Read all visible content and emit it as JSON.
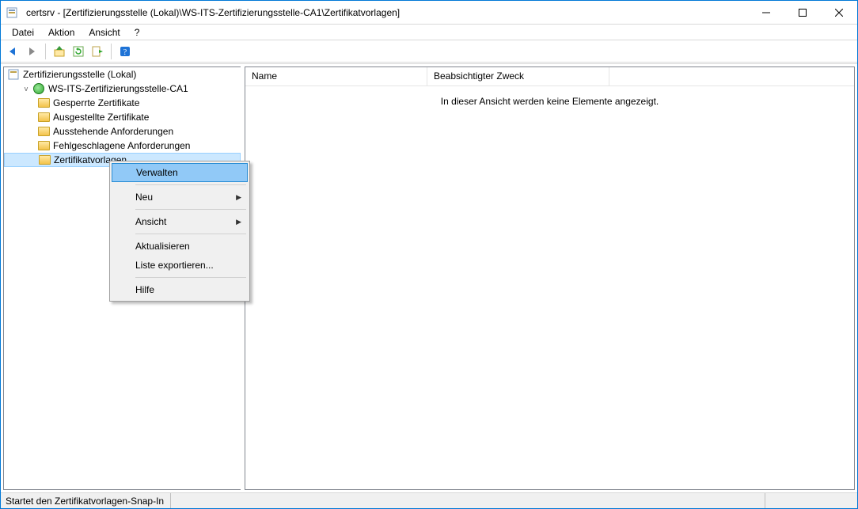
{
  "window": {
    "title": "certsrv - [Zertifizierungsstelle (Lokal)\\WS-ITS-Zertifizierungsstelle-CA1\\Zertifikatvorlagen]"
  },
  "menu": {
    "file": "Datei",
    "action": "Aktion",
    "view": "Ansicht",
    "help": "?"
  },
  "tree": {
    "root": "Zertifizierungsstelle (Lokal)",
    "ca": "WS-ITS-Zertifizierungsstelle-CA1",
    "nodes": {
      "revoked": "Gesperrte Zertifikate",
      "issued": "Ausgestellte Zertifikate",
      "pending": "Ausstehende Anforderungen",
      "failed": "Fehlgeschlagene Anforderungen",
      "templates": "Zertifikatvorlagen"
    }
  },
  "list": {
    "col_name": "Name",
    "col_purpose": "Beabsichtigter Zweck",
    "empty": "In dieser Ansicht werden keine Elemente angezeigt."
  },
  "ctx": {
    "manage": "Verwalten",
    "new": "Neu",
    "view": "Ansicht",
    "refresh": "Aktualisieren",
    "export": "Liste exportieren...",
    "help": "Hilfe"
  },
  "status": {
    "text": "Startet den Zertifikatvorlagen-Snap-In"
  }
}
